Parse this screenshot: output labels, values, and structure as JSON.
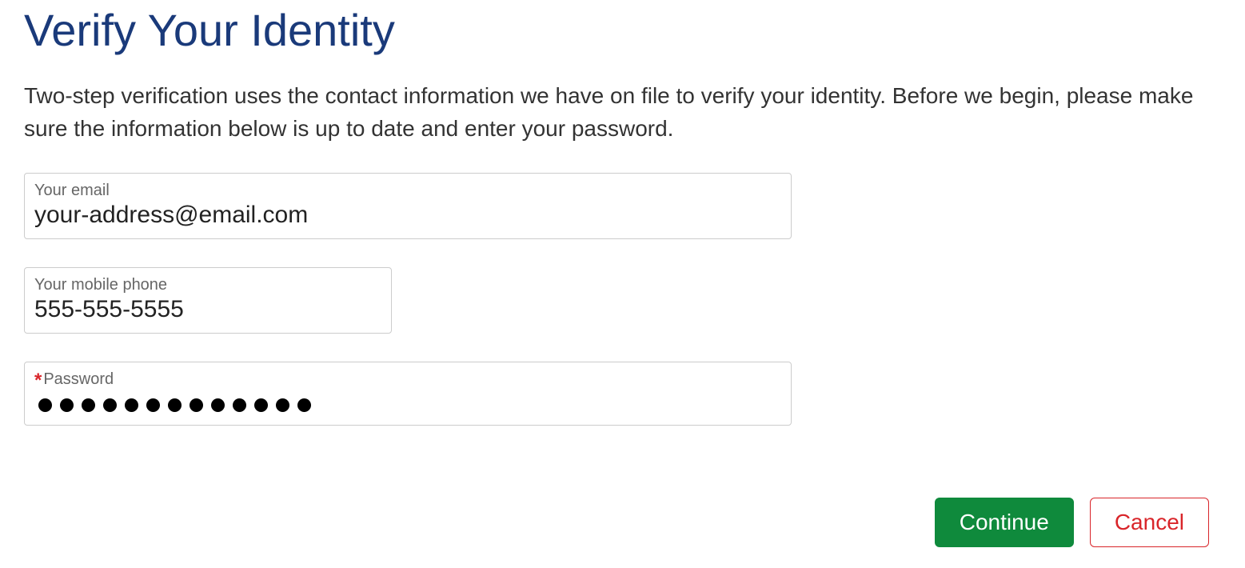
{
  "title": "Verify Your Identity",
  "description": "Two-step verification uses the contact information we have on file to verify your identity. Before we begin, please make sure the information below is up to date and enter your password.",
  "fields": {
    "email": {
      "label": "Your email",
      "value": "your-address@email.com"
    },
    "phone": {
      "label": "Your mobile phone",
      "value": "555-555-5555"
    },
    "password": {
      "label": "Password",
      "required_marker": "*",
      "masked_length": 13
    }
  },
  "buttons": {
    "continue": "Continue",
    "cancel": "Cancel"
  }
}
